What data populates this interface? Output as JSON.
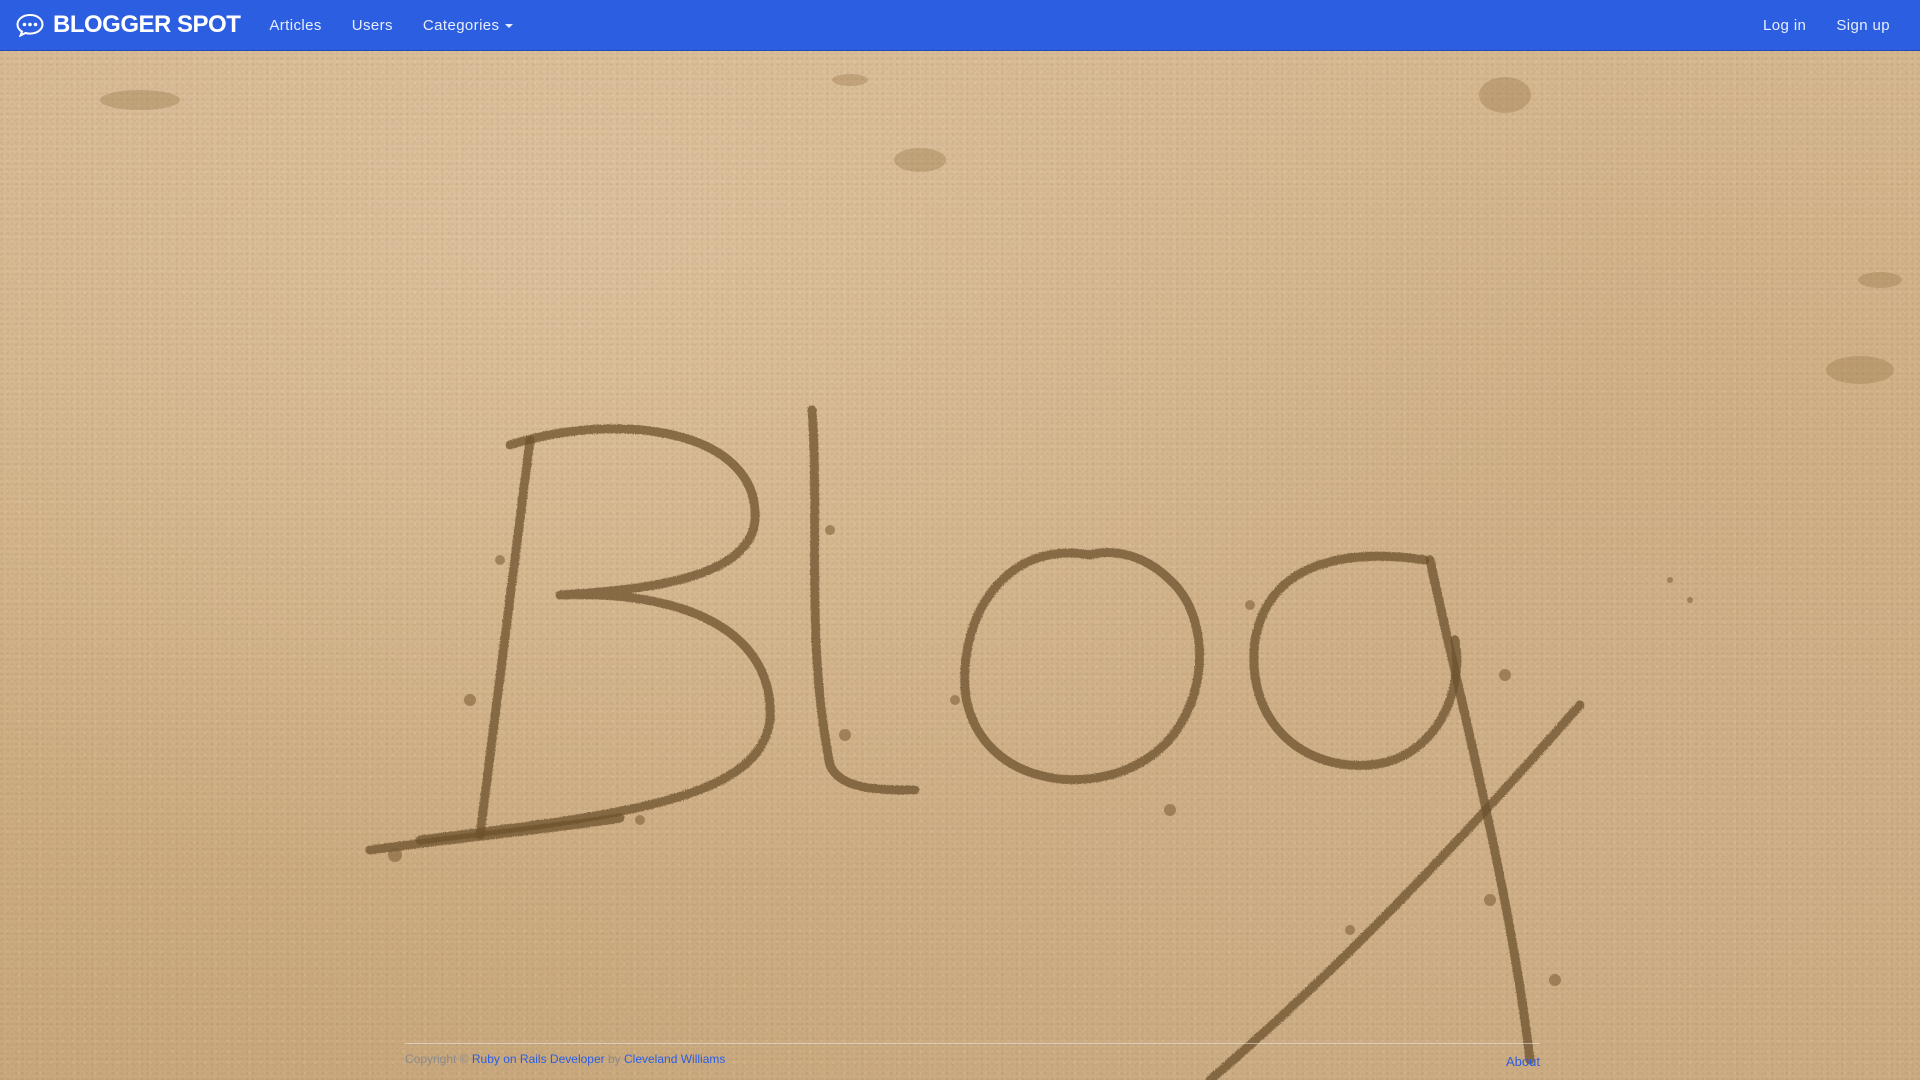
{
  "navbar": {
    "brand_name": "BLOGGER SPOT",
    "brand_icon": "speech-bubble-icon",
    "links": {
      "articles": "Articles",
      "users": "Users",
      "categories": "Categories"
    },
    "auth": {
      "login": "Log in",
      "signup": "Sign up"
    },
    "background_color": "#2b5ee0"
  },
  "hero": {
    "sand_text": "Blog"
  },
  "footer": {
    "copyright_prefix": "Copyright ©",
    "developer_link": "Ruby on Rails Developer",
    "by_text": "by",
    "author_link": "Cleveland Williams",
    "about_link": "About"
  }
}
